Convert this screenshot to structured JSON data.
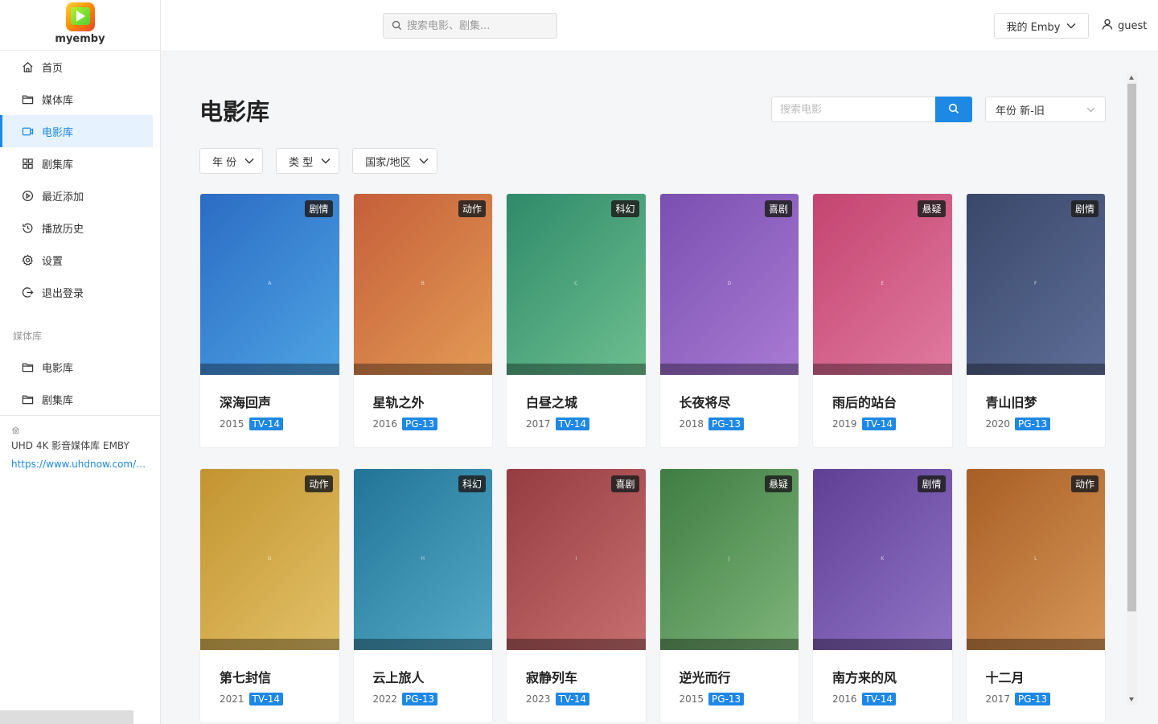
{
  "brand": {
    "name": "myemby",
    "logo_icon": "play-logo-icon"
  },
  "sidebar": {
    "items": [
      {
        "label": "首页",
        "icon": "home-icon"
      },
      {
        "label": "媒体库",
        "icon": "folder-icon"
      },
      {
        "label": "电影库",
        "icon": "video-icon",
        "active": true
      },
      {
        "label": "剧集库",
        "icon": "grid-icon"
      },
      {
        "label": "最近添加",
        "icon": "play-circle-icon"
      },
      {
        "label": "播放历史",
        "icon": "history-icon"
      },
      {
        "label": "设置",
        "icon": "gear-icon"
      },
      {
        "label": "退出登录",
        "icon": "logout-icon"
      }
    ],
    "section_label": "媒体库",
    "library_items": [
      {
        "label": "电影库",
        "icon": "folder-icon"
      },
      {
        "label": "剧集库",
        "icon": "folder-icon"
      }
    ],
    "footer": {
      "site_name": "UHD 4K 影音媒体库 EMBY",
      "link": "https://www.uhdnow.com/sig..."
    }
  },
  "topbar": {
    "search_placeholder": "搜索电影、剧集...",
    "emby_button": "我的 Emby",
    "username": "guest"
  },
  "main": {
    "title": "电影库",
    "search_placeholder": "搜索电影",
    "sort_value": "年份 新-旧",
    "filters": [
      "年 份",
      "类 型",
      "国家/地区"
    ]
  },
  "colors": {
    "accent": "#1e88e5"
  },
  "movies": [
    {
      "title": "深海回声",
      "year": "2015",
      "rating": "TV-14",
      "genre": "剧情",
      "letter": "A",
      "c1": "#2b6cc4",
      "c2": "#4ea3e3"
    },
    {
      "title": "星轨之外",
      "year": "2016",
      "rating": "PG-13",
      "genre": "动作",
      "letter": "B",
      "c1": "#c55f3a",
      "c2": "#e39a55"
    },
    {
      "title": "白昼之城",
      "year": "2017",
      "rating": "TV-14",
      "genre": "科幻",
      "letter": "C",
      "c1": "#2f8a6a",
      "c2": "#6dbf8f"
    },
    {
      "title": "长夜将尽",
      "year": "2018",
      "rating": "PG-13",
      "genre": "喜剧",
      "letter": "D",
      "c1": "#7a4fb0",
      "c2": "#a97bd4"
    },
    {
      "title": "雨后的站台",
      "year": "2019",
      "rating": "TV-14",
      "genre": "悬疑",
      "letter": "E",
      "c1": "#c44470",
      "c2": "#e07a9e"
    },
    {
      "title": "青山旧梦",
      "year": "2020",
      "rating": "PG-13",
      "genre": "剧情",
      "letter": "F",
      "c1": "#39476a",
      "c2": "#5f6e97"
    },
    {
      "title": "第七封信",
      "year": "2021",
      "rating": "TV-14",
      "genre": "动作",
      "letter": "G",
      "c1": "#c29430",
      "c2": "#e3c168"
    },
    {
      "title": "云上旅人",
      "year": "2022",
      "rating": "PG-13",
      "genre": "科幻",
      "letter": "H",
      "c1": "#217496",
      "c2": "#55aac8"
    },
    {
      "title": "寂静列车",
      "year": "2023",
      "rating": "TV-14",
      "genre": "喜剧",
      "letter": "I",
      "c1": "#943c40",
      "c2": "#c76f70"
    },
    {
      "title": "逆光而行",
      "year": "2015",
      "rating": "PG-13",
      "genre": "悬疑",
      "letter": "J",
      "c1": "#3f7d42",
      "c2": "#7eb57b"
    },
    {
      "title": "南方来的风",
      "year": "2016",
      "rating": "TV-14",
      "genre": "剧情",
      "letter": "K",
      "c1": "#5e3f94",
      "c2": "#9173c6"
    },
    {
      "title": "十二月",
      "year": "2017",
      "rating": "PG-13",
      "genre": "动作",
      "letter": "L",
      "c1": "#a85e24",
      "c2": "#d69658"
    }
  ]
}
